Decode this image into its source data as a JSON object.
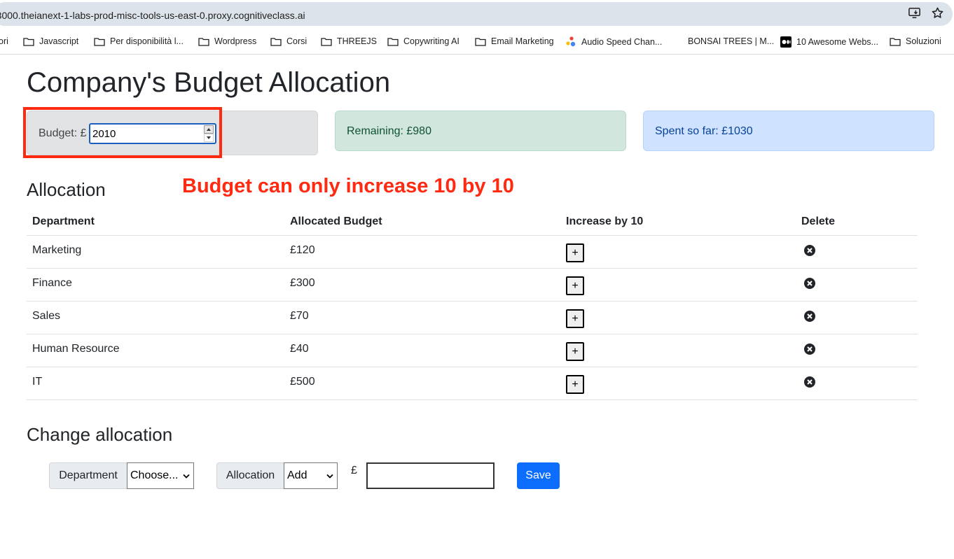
{
  "browser": {
    "url": "-3000.theianext-1-labs-prod-misc-tools-us-east-0.proxy.cognitiveclass.ai",
    "bookmarks": [
      {
        "label": "ori",
        "icon": "none"
      },
      {
        "label": "Javascript",
        "icon": "folder-icon"
      },
      {
        "label": "Per disponibilità l...",
        "icon": "folder-icon"
      },
      {
        "label": "Wordpress",
        "icon": "folder-icon"
      },
      {
        "label": "Corsi",
        "icon": "folder-icon"
      },
      {
        "label": "THREEJS",
        "icon": "folder-icon"
      },
      {
        "label": "Copywriting AI",
        "icon": "folder-icon"
      },
      {
        "label": "Email Marketing",
        "icon": "folder-icon"
      },
      {
        "label": "Audio Speed Chan...",
        "icon": "dots-icon"
      },
      {
        "label": "BONSAI TREES | M...",
        "icon": "none"
      },
      {
        "label": "10 Awesome Webs...",
        "icon": "medium-icon"
      },
      {
        "label": "Soluzioni",
        "icon": "folder-icon"
      }
    ]
  },
  "page": {
    "title": "Company's Budget Allocation",
    "budget_label": "Budget: £",
    "budget_value": "2010",
    "remaining": "Remaining: £980",
    "spent": "Spent so far: £1030",
    "annotation": "Budget can only increase 10 by 10"
  },
  "allocation": {
    "heading": "Allocation",
    "columns": [
      "Department",
      "Allocated Budget",
      "Increase by 10",
      "Delete"
    ],
    "rows": [
      {
        "department": "Marketing",
        "budget": "£120"
      },
      {
        "department": "Finance",
        "budget": "£300"
      },
      {
        "department": "Sales",
        "budget": "£70"
      },
      {
        "department": "Human Resource",
        "budget": "£40"
      },
      {
        "department": "IT",
        "budget": "£500"
      }
    ],
    "increase_label": "+"
  },
  "change": {
    "heading": "Change allocation",
    "department_label": "Department",
    "department_selected": "Choose...",
    "allocation_label": "Allocation",
    "allocation_selected": "Add",
    "currency": "£",
    "save_label": "Save"
  },
  "colors": {
    "annotation": "#ff2a12",
    "save_button": "#0d6efd",
    "remaining_bg": "#d1e7dd",
    "spent_bg": "#cfe2ff"
  }
}
